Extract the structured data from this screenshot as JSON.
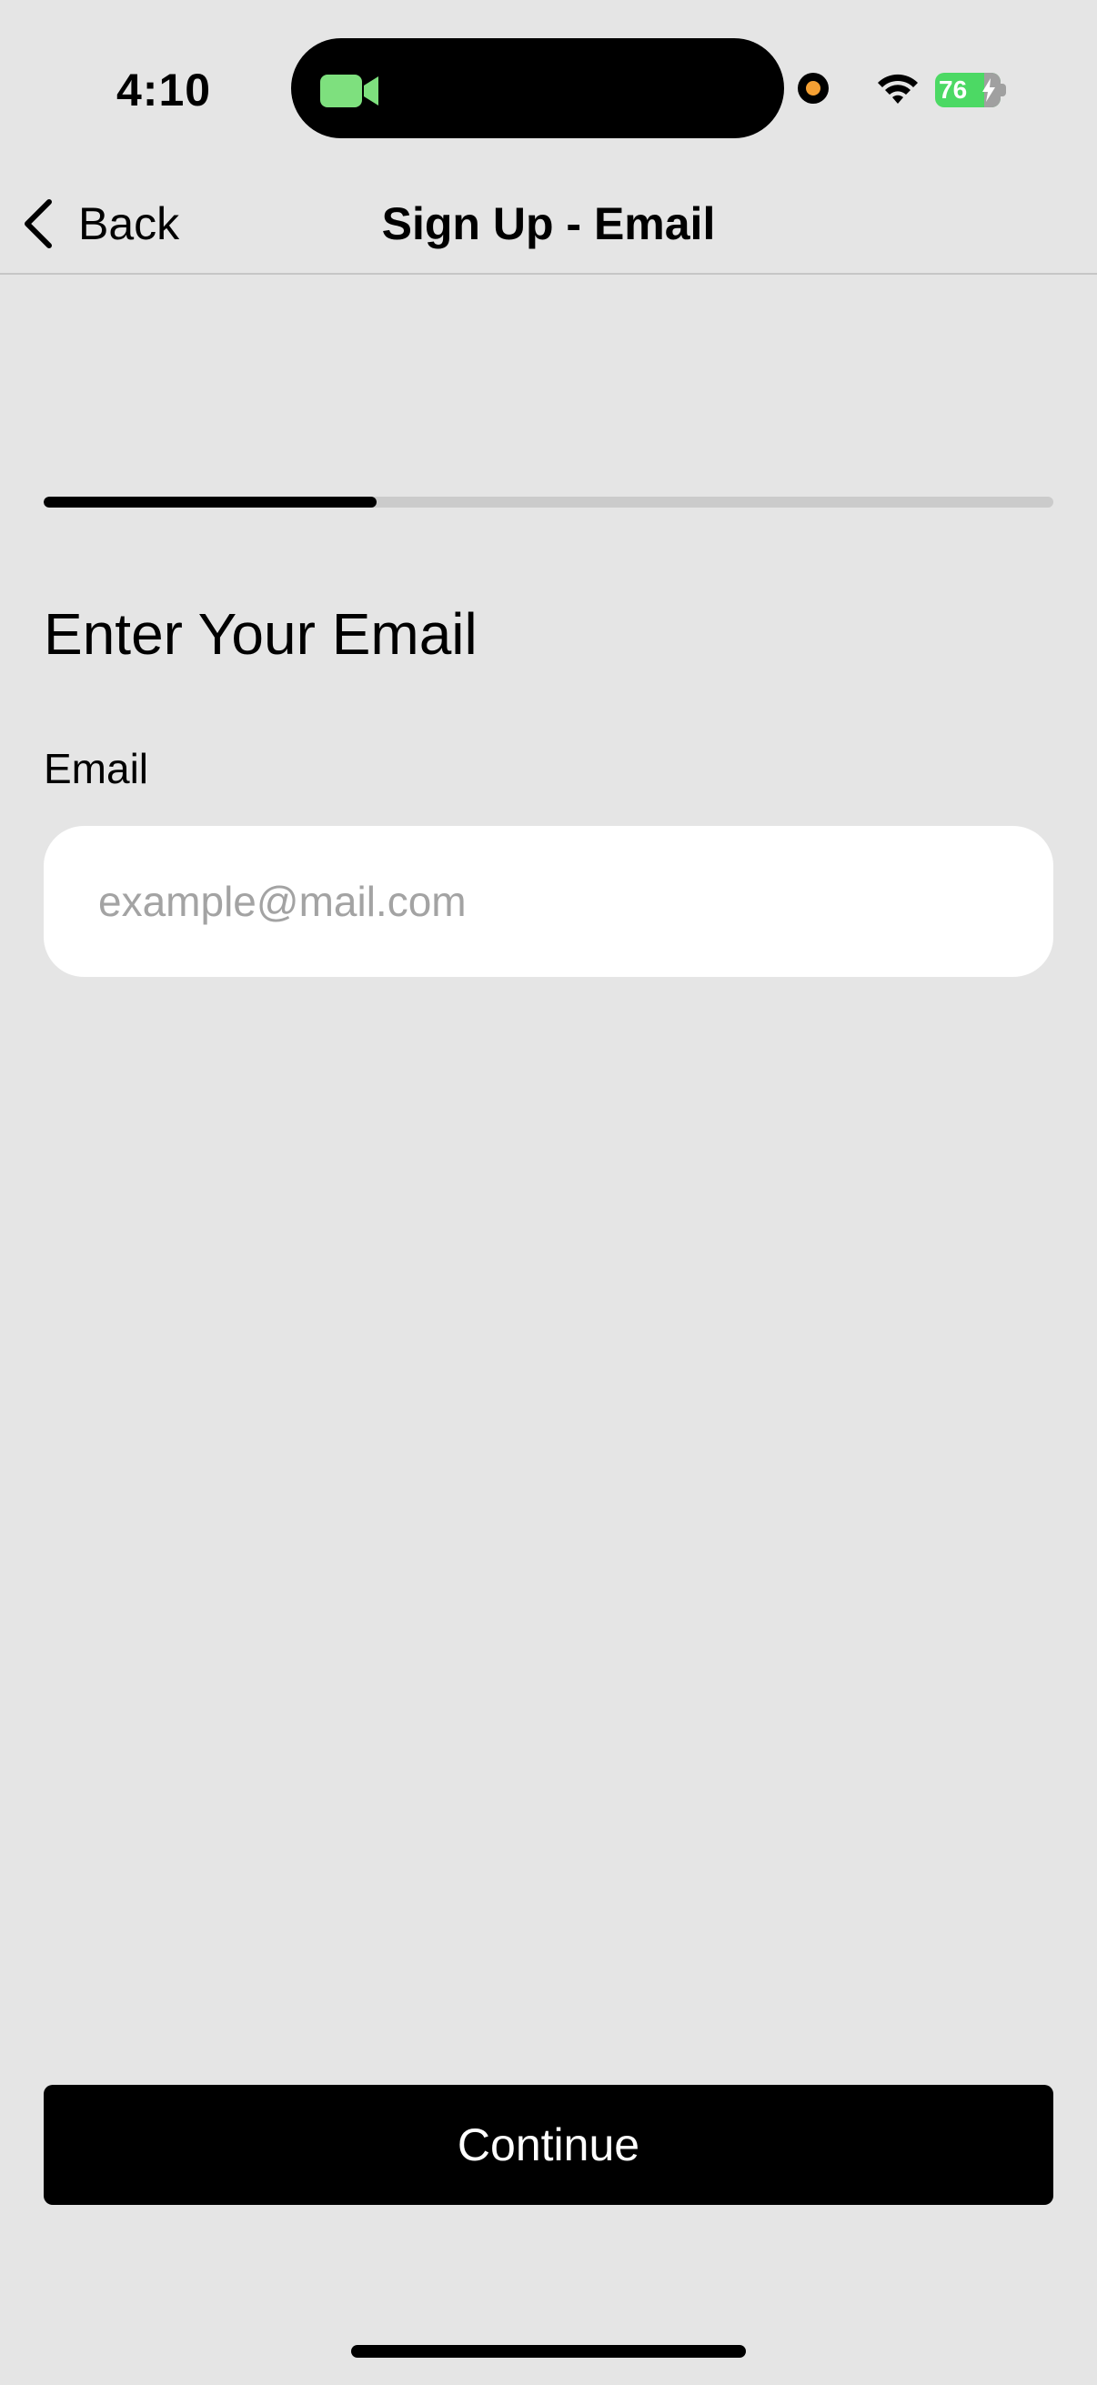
{
  "status_bar": {
    "time": "4:10",
    "battery_level": "76",
    "battery_charging": true,
    "icons": [
      "camera-icon",
      "recording-dot",
      "wifi-icon",
      "battery-icon"
    ],
    "colors": {
      "camera": "#7ee07e",
      "recording_dot": "#f5a033",
      "battery": "#4cd964"
    }
  },
  "nav": {
    "back_label": "Back",
    "title": "Sign Up - Email"
  },
  "progress": {
    "fraction": 0.33
  },
  "form": {
    "heading": "Enter Your Email",
    "email_label": "Email",
    "email_placeholder": "example@mail.com",
    "email_value": ""
  },
  "actions": {
    "continue_label": "Continue"
  }
}
